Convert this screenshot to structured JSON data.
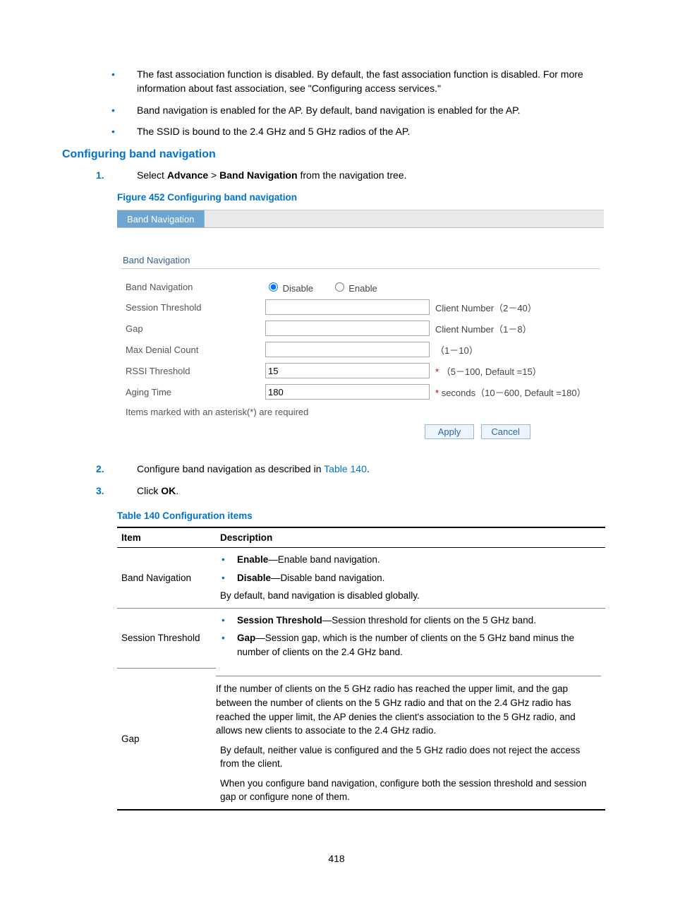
{
  "intro_bullets": [
    "The fast association function is disabled. By default, the fast association function is disabled. For more information about fast association, see \"Configuring access services.\"",
    "Band navigation is enabled for the AP. By default, band navigation is enabled for the AP.",
    "The SSID is bound to the 2.4 GHz and 5 GHz radios of the AP."
  ],
  "heading": "Configuring band navigation",
  "steps": {
    "s1_prefix": "Select ",
    "s1_bold1": "Advance",
    "s1_sep": " > ",
    "s1_bold2": "Band Navigation",
    "s1_suffix": " from the navigation tree.",
    "s2_prefix": "Configure band navigation as described in ",
    "s2_link": "Table 140",
    "s2_suffix": ".",
    "s3_prefix": "Click ",
    "s3_bold": "OK",
    "s3_suffix": "."
  },
  "figure_caption": "Figure 452 Configuring band navigation",
  "screenshot": {
    "tab": "Band Navigation",
    "title": "Band Navigation",
    "rows": {
      "band_nav": {
        "label": "Band Navigation",
        "opt_disable": "Disable",
        "opt_enable": "Enable"
      },
      "session": {
        "label": "Session Threshold",
        "value": "",
        "hint": "Client Number（2－40）"
      },
      "gap": {
        "label": "Gap",
        "value": "",
        "hint": "Client Number（1－8）"
      },
      "maxden": {
        "label": "Max Denial Count",
        "value": "",
        "hint": "（1－10）"
      },
      "rssi": {
        "label": "RSSI Threshold",
        "value": "15",
        "hint": "（5－100, Default =15）"
      },
      "aging": {
        "label": "Aging Time",
        "value": "180",
        "hint": "seconds（10－600, Default =180）"
      }
    },
    "asterisk": "*",
    "note": "Items marked with an asterisk(*) are required",
    "btn_apply": "Apply",
    "btn_cancel": "Cancel"
  },
  "table_caption": "Table 140 Configuration items",
  "table": {
    "head_item": "Item",
    "head_desc": "Description",
    "r1": {
      "item": "Band Navigation",
      "b1_bold": "Enable",
      "b1_rest": "—Enable band navigation.",
      "b2_bold": "Disable",
      "b2_rest": "—Disable band navigation.",
      "foot": "By default, band navigation is disabled globally."
    },
    "r2": {
      "item": "Session Threshold",
      "b1_bold": "Session Threshold",
      "b1_rest": "—Session threshold for clients on the 5 GHz band.",
      "b2_bold": "Gap",
      "b2_rest": "—Session gap, which is the number of clients on the 5 GHz band minus the number of clients on the 2.4 GHz band."
    },
    "r3": {
      "item": "Gap",
      "p1": "If the number of clients on the 5 GHz radio has reached the upper limit, and the gap between the number of clients on the 5 GHz radio and that on the 2.4 GHz radio has reached the upper limit, the AP denies the client's association to the 5 GHz radio, and allows new clients to associate to the 2.4 GHz radio.",
      "p2": "By default, neither value is configured and the 5 GHz radio does not reject the access from the client.",
      "p3": "When you configure band navigation, configure both the session threshold and session gap or configure none of them."
    }
  },
  "page_number": "418"
}
